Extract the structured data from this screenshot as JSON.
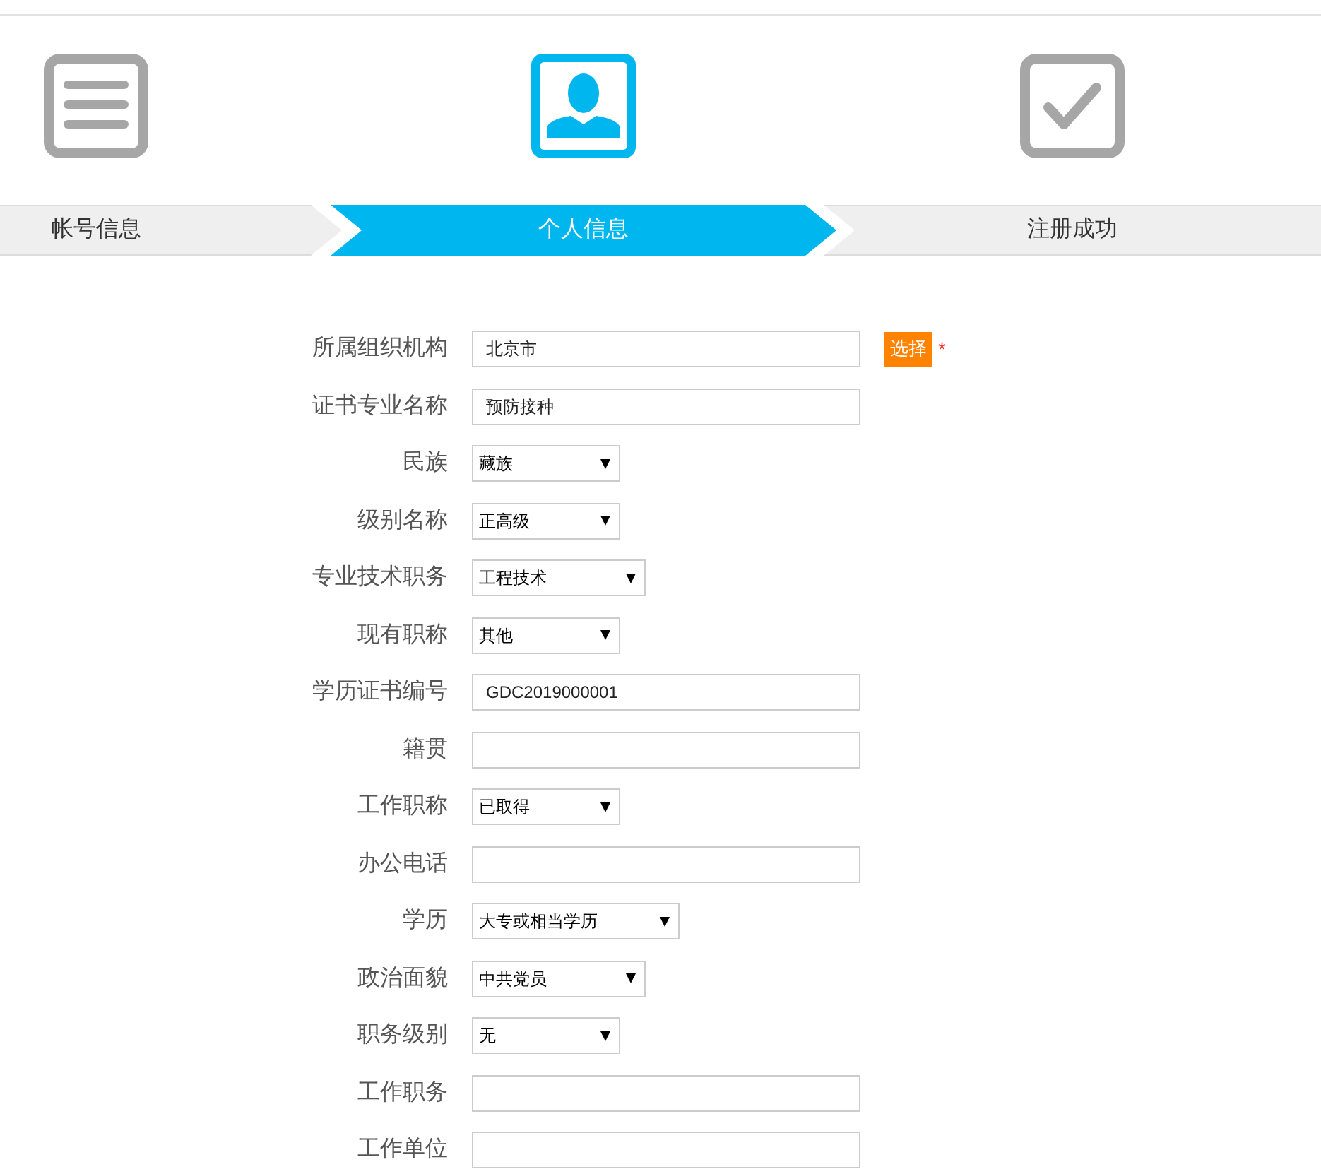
{
  "steps": [
    {
      "label": "帐号信息",
      "kind": "list",
      "selected": false
    },
    {
      "label": "个人信息",
      "kind": "person",
      "selected": true
    },
    {
      "label": "注册成功",
      "kind": "check",
      "selected": false
    }
  ],
  "form": {
    "fields": [
      {
        "label": "所属组织机构",
        "kind": "text",
        "value": "北京市",
        "action": "选择",
        "required_mark": "*"
      },
      {
        "label": "证书专业名称",
        "kind": "text",
        "value": "预防接种"
      },
      {
        "label": "民族",
        "kind": "select",
        "value": "藏族"
      },
      {
        "label": "级别名称",
        "kind": "select",
        "value": "正高级"
      },
      {
        "label": "专业技术职务",
        "kind": "select",
        "value": "工程技术"
      },
      {
        "label": "现有职称",
        "kind": "select",
        "value": "其他"
      },
      {
        "label": "学历证书编号",
        "kind": "text",
        "value": "GDC2019000001"
      },
      {
        "label": "籍贯",
        "kind": "text"
      },
      {
        "label": "工作职称",
        "kind": "select",
        "value": "已取得"
      },
      {
        "label": "办公电话",
        "kind": "text"
      },
      {
        "label": "学历",
        "kind": "select",
        "value": "大专或相当学历"
      },
      {
        "label": "政治面貌",
        "kind": "select",
        "value": "中共党员"
      },
      {
        "label": "职务级别",
        "kind": "select",
        "value": "无"
      },
      {
        "label": "工作职务",
        "kind": "text"
      },
      {
        "label": "工作单位",
        "kind": "text"
      }
    ]
  }
}
